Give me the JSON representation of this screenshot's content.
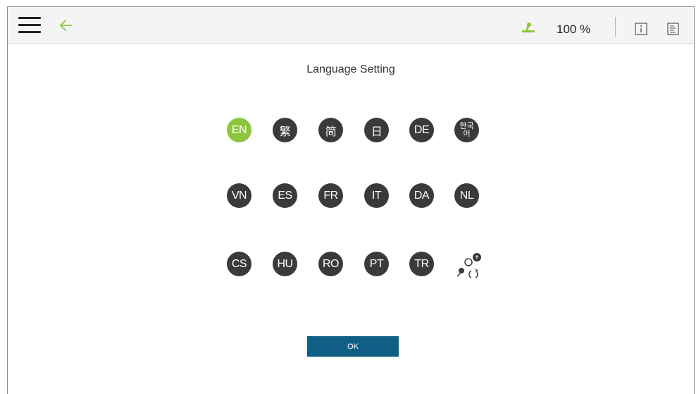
{
  "header": {
    "zoom_text": "100 %",
    "accent_color": "#8cc63f",
    "icons": [
      "menu-icon",
      "back-arrow-icon",
      "robot-arm-icon",
      "info-icon",
      "log-icon"
    ]
  },
  "title": "Language Setting",
  "languages": [
    {
      "label": "EN",
      "selected": true
    },
    {
      "label": "繁",
      "selected": false
    },
    {
      "label": "简",
      "selected": false
    },
    {
      "label": "日",
      "selected": false
    },
    {
      "label": "DE",
      "selected": false
    },
    {
      "label": "한국어",
      "selected": false
    },
    {
      "label": "VN",
      "selected": false
    },
    {
      "label": "ES",
      "selected": false
    },
    {
      "label": "FR",
      "selected": false
    },
    {
      "label": "IT",
      "selected": false
    },
    {
      "label": "DA",
      "selected": false
    },
    {
      "label": "NL",
      "selected": false
    },
    {
      "label": "CS",
      "selected": false
    },
    {
      "label": "HU",
      "selected": false
    },
    {
      "label": "RO",
      "selected": false
    },
    {
      "label": "PT",
      "selected": false
    },
    {
      "label": "TR",
      "selected": false
    }
  ],
  "other_language_icon": "translate-icon",
  "ok_label": "OK",
  "ok_color": "#0f5f86"
}
